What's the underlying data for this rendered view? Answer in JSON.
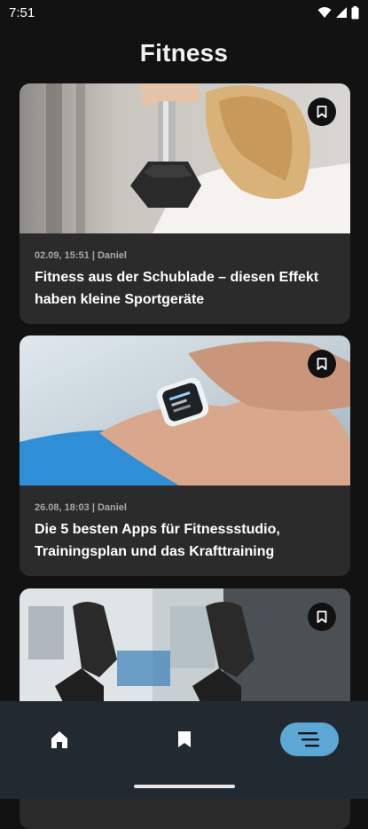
{
  "status": {
    "time": "7:51"
  },
  "page": {
    "title": "Fitness"
  },
  "articles": [
    {
      "meta": "02.09, 15:51 | Daniel",
      "title": "Fitness aus der Schublade – diesen Effekt haben kleine Sportgeräte"
    },
    {
      "meta": "26.08, 18:03 | Daniel",
      "title": "Die 5 besten Apps für Fitnessstudio, Trainingsplan und das Krafttraining"
    },
    {
      "meta": "",
      "title": ""
    }
  ],
  "icons": {
    "wifi": "wifi-icon",
    "signal": "signal-icon",
    "battery": "battery-icon",
    "bookmark": "bookmark-icon",
    "home": "home-icon",
    "menu": "menu-icon"
  },
  "colors": {
    "background": "#121212",
    "card": "#2b2b2b",
    "nav": "#212a30",
    "accent": "#5aa8d3"
  }
}
